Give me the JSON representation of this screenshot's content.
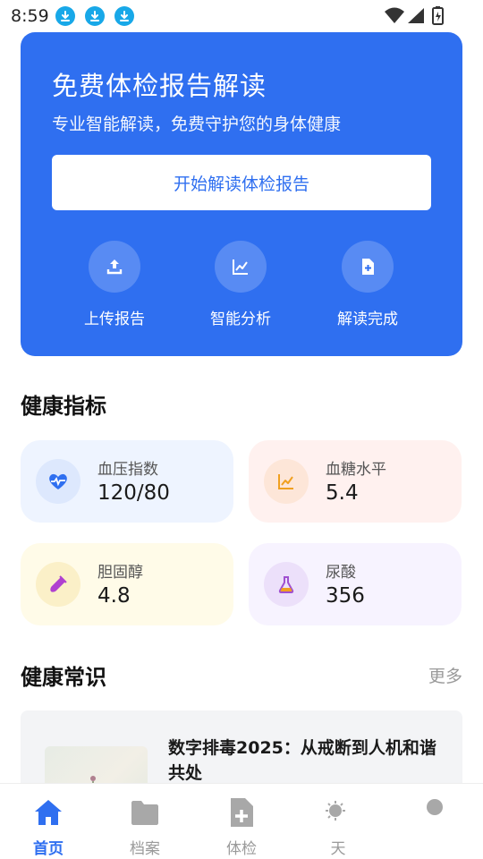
{
  "status_bar": {
    "time": "8:59"
  },
  "hero": {
    "title": "免费体检报告解读",
    "subtitle": "专业智能解读，免费守护您的身体健康",
    "button_label": "开始解读体检报告",
    "steps": [
      {
        "label": "上传报告",
        "icon": "upload-icon"
      },
      {
        "label": "智能分析",
        "icon": "chart-line-icon"
      },
      {
        "label": "解读完成",
        "icon": "document-plus-icon"
      }
    ]
  },
  "metrics_section": {
    "title": "健康指标",
    "items": [
      {
        "label": "血压指数",
        "value": "120/80",
        "icon": "heartbeat-icon",
        "color": "#2f6ff0",
        "bg": "#eef4ff"
      },
      {
        "label": "血糖水平",
        "value": "5.4",
        "icon": "chart-line-icon",
        "color": "#f0a020",
        "bg": "#fff1ef"
      },
      {
        "label": "胆固醇",
        "value": "4.8",
        "icon": "test-tube-icon",
        "color": "#b040d0",
        "bg": "#fffbe8"
      },
      {
        "label": "尿酸",
        "value": "356",
        "icon": "flask-icon",
        "color": "#a050d0",
        "bg": "#f7f3ff"
      }
    ]
  },
  "knowledge_section": {
    "title": "健康常识",
    "more_label": "更多",
    "article": {
      "title": "数字排毒2025：从戒断到人机和谐共处"
    }
  },
  "bottom_nav": {
    "items": [
      {
        "label": "首页",
        "icon": "home-icon",
        "active": true
      },
      {
        "label": "档案",
        "icon": "folder-icon",
        "active": false
      },
      {
        "label": "体检",
        "icon": "medical-document-icon",
        "active": false
      },
      {
        "label": "天",
        "icon": "weather-icon",
        "active": false
      },
      {
        "label": "",
        "icon": "profile-icon",
        "active": false
      }
    ]
  },
  "colors": {
    "primary": "#2f6ff0",
    "inactive_nav": "#9a9a9a"
  }
}
